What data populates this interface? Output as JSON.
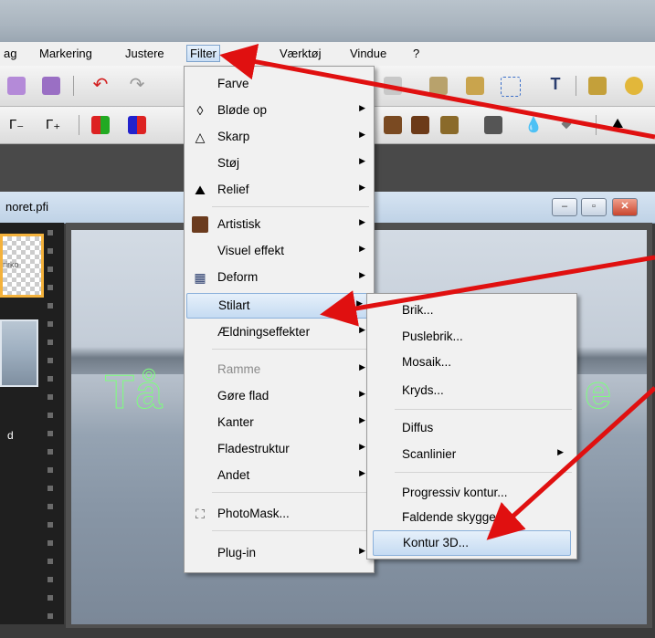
{
  "menubar": {
    "items": [
      "ag",
      "Markering",
      "Justere",
      "Filter",
      "Vis",
      "Værktøj",
      "Vindue",
      "?"
    ]
  },
  "document": {
    "title": "noret.pfi",
    "window_buttons": {
      "minimize": "–",
      "maximize": "▫",
      "close": "✕"
    },
    "thumb1_text": "rirko",
    "thumb2_label": "d",
    "canvas_text_left": "Tå",
    "canvas_text_right": "e"
  },
  "filter_menu": {
    "items": [
      {
        "label": "Farve",
        "icon": "",
        "arrow": false
      },
      {
        "label": "Bløde op",
        "icon": "drop-outline-icon",
        "arrow": true
      },
      {
        "label": "Skarp",
        "icon": "triangle-outline-icon",
        "arrow": true
      },
      {
        "label": "Støj",
        "icon": "",
        "arrow": true
      },
      {
        "label": "Relief",
        "icon": "relief-icon",
        "arrow": true
      },
      {
        "label": "Artistisk",
        "icon": "portrait-icon",
        "arrow": true
      },
      {
        "label": "Visuel effekt",
        "icon": "",
        "arrow": true
      },
      {
        "label": "Deform",
        "icon": "grid-icon",
        "arrow": true
      },
      {
        "label": "Stilart",
        "icon": "",
        "arrow": true
      },
      {
        "label": "Ældningseffekter",
        "icon": "",
        "arrow": true
      },
      {
        "label": "Ramme",
        "icon": "",
        "arrow": true
      },
      {
        "label": "Gøre flad",
        "icon": "",
        "arrow": true
      },
      {
        "label": "Kanter",
        "icon": "",
        "arrow": true
      },
      {
        "label": "Fladestruktur",
        "icon": "",
        "arrow": true
      },
      {
        "label": "Andet",
        "icon": "",
        "arrow": true
      },
      {
        "label": "PhotoMask...",
        "icon": "photomask-icon",
        "arrow": false
      },
      {
        "label": "Plug-in",
        "icon": "",
        "arrow": true
      }
    ]
  },
  "stilart_submenu": {
    "items": [
      {
        "label": "Brik...",
        "arrow": false
      },
      {
        "label": "Puslebrik...",
        "arrow": false
      },
      {
        "label": "Mosaik...",
        "arrow": false
      },
      {
        "label": "Kryds...",
        "arrow": false
      },
      {
        "label": "Diffus",
        "arrow": false
      },
      {
        "label": "Scanlinier",
        "arrow": true
      },
      {
        "label": "Progressiv kontur...",
        "arrow": false
      },
      {
        "label": "Faldende skygge...",
        "arrow": false
      },
      {
        "label": "Kontur 3D...",
        "arrow": false
      }
    ]
  },
  "colors": {
    "annotation_arrow": "#e01010",
    "selection_outline": "#7dff7d",
    "menu_highlight": "#c5dbf2"
  }
}
